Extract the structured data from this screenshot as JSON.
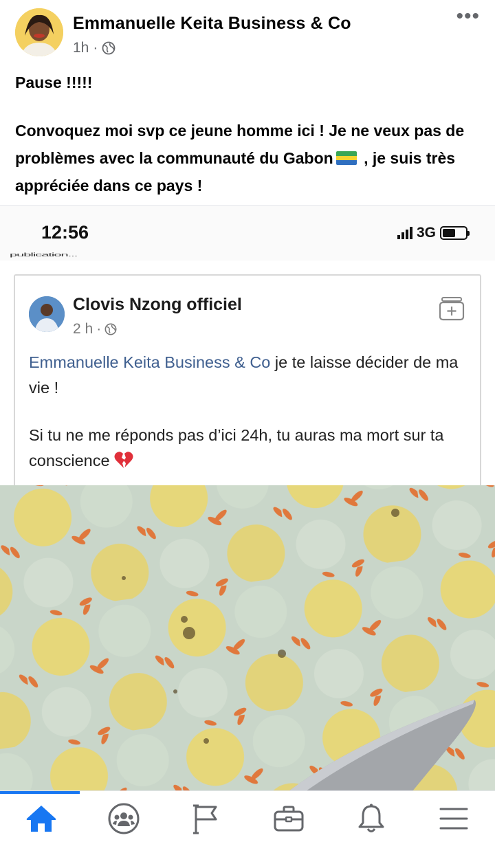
{
  "post": {
    "author": "Emmanuelle Keita Business & Co",
    "time": "1h",
    "separator": "·",
    "more": "•••",
    "text": {
      "line1": "Pause !!!!!",
      "para2_before_flag": "Convoquez moi  svp ce jeune homme ici ! Je ne veux pas de problèmes avec la communauté du Gabon",
      "para2_after_flag": " , je suis très appréciée dans ce pays !"
    },
    "flag_colors": [
      "#3aa655",
      "#f5d430",
      "#2f6fc0"
    ]
  },
  "shared_screenshot": {
    "status_bar": {
      "time": "12:56",
      "network": "3G"
    },
    "truncated_text": "publication...",
    "inner_post": {
      "author": "Clovis Nzong officiel",
      "time": "2 h",
      "separator": "·",
      "mention": "Emmanuelle Keita Business & Co",
      "text_after_mention": " je te laisse décider de ma vie !",
      "paragraph2": "Si tu ne me réponds pas d’ici 24h, tu auras ma mort sur ta conscience"
    }
  },
  "bottom_nav": {
    "items": [
      {
        "name": "home-icon",
        "active": true
      },
      {
        "name": "groups-icon",
        "active": false
      },
      {
        "name": "pages-flag-icon",
        "active": false
      },
      {
        "name": "marketplace-briefcase-icon",
        "active": false
      },
      {
        "name": "notifications-bell-icon",
        "active": false
      },
      {
        "name": "menu-icon",
        "active": false
      }
    ],
    "accent_color": "#1877f2",
    "icon_color": "#65676b"
  }
}
